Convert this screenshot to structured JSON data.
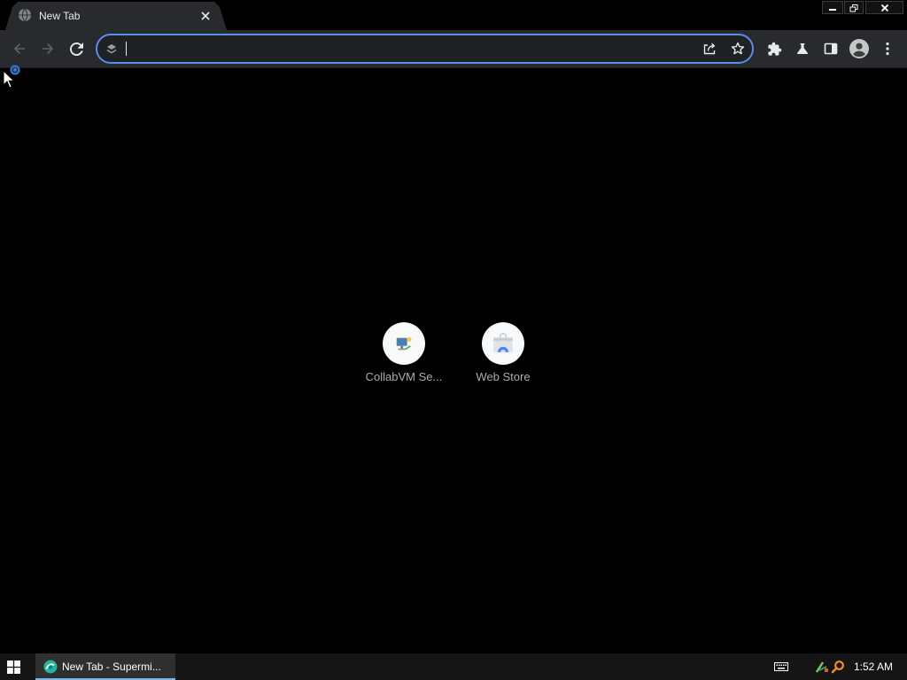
{
  "window": {
    "tab": {
      "title": "New Tab",
      "favicon_icon": "globe-icon",
      "close_icon": "close-icon"
    },
    "controls": [
      "minimize-icon",
      "restore-icon",
      "close-icon"
    ]
  },
  "toolbar": {
    "back": {
      "icon": "arrow-left-icon",
      "enabled": false
    },
    "forward": {
      "icon": "arrow-right-icon",
      "enabled": false
    },
    "reload": {
      "icon": "reload-icon",
      "enabled": true
    },
    "omnibox": {
      "value": "",
      "focused": true,
      "leading_icon": "search-engine-icon",
      "trailing_icons": [
        "share-icon",
        "star-icon"
      ]
    },
    "right_icons": [
      "puzzle-icon",
      "flask-icon",
      "side-panel-icon",
      "avatar-icon",
      "kebab-menu-icon"
    ]
  },
  "new_tab_page": {
    "shortcuts": [
      {
        "label": "CollabVM Se...",
        "icon": "collabvm-icon"
      },
      {
        "label": "Web Store",
        "icon": "web-store-icon"
      }
    ]
  },
  "taskbar": {
    "start_icon": "windows-logo-icon",
    "active_window": {
      "label": "New Tab - Supermi...",
      "icon": "supermium-icon"
    },
    "tray_icons": [
      "keyboard-icon",
      "network-icon",
      "magnifier-icon"
    ],
    "clock": "1:52 AM"
  },
  "colors": {
    "page_background": "#000000",
    "toolbar": "#292a2d",
    "omnibox_focus_ring": "#5b8def",
    "taskbar": "#151515",
    "taskbar_active_indicator": "#76b9ed"
  }
}
